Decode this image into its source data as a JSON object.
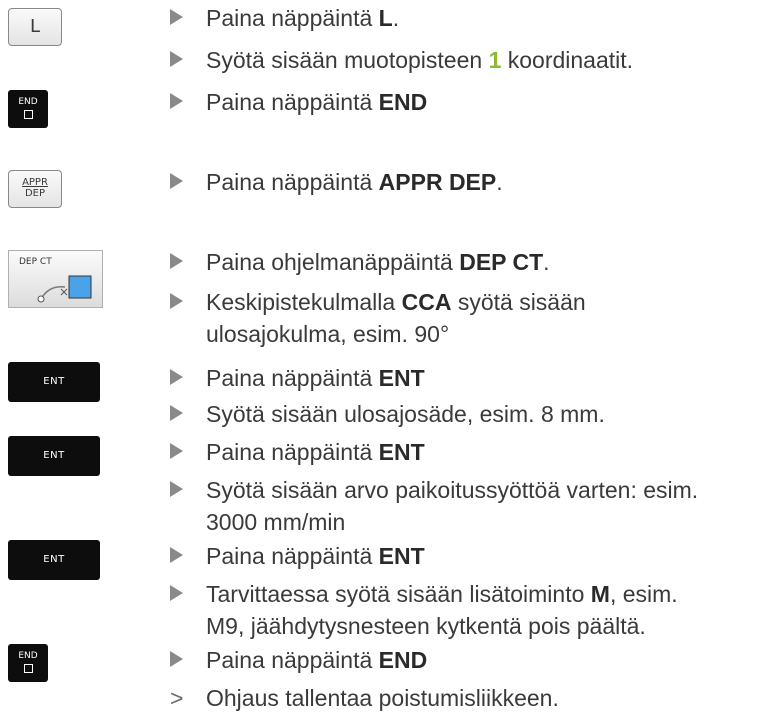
{
  "keys": {
    "L": "L",
    "end_1": "END",
    "appr_top": "APPR",
    "appr_bottom": "DEP",
    "softkey": "DEP CT",
    "ent_1": "ENT",
    "ent_2": "ENT",
    "ent_3": "ENT",
    "end_2": "END"
  },
  "steps": [
    {
      "pre": "Paina näppäintä ",
      "bold": "L",
      "post": "."
    },
    {
      "pre": "Syötä sisään muotopisteen ",
      "hl": "1",
      "post": " koordinaatit."
    },
    {
      "pre": "Paina näppäintä ",
      "bold": "END",
      "post": ""
    },
    {
      "pre": "Paina näppäintä ",
      "bold": "APPR DEP",
      "post": "."
    },
    {
      "pre": "Paina ohjelmanäppäintä ",
      "bold": "DEP CT",
      "post": "."
    },
    {
      "pre": "Keskipistekulmalla ",
      "bold": "CCA",
      "line1_post": " syötä sisään",
      "line2": "ulosajokulma, esim. 90°"
    },
    {
      "pre": "Paina näppäintä ",
      "bold": "ENT",
      "post": ""
    },
    {
      "text": "Syötä sisään ulosajosäde, esim. 8 mm."
    },
    {
      "pre": "Paina näppäintä ",
      "bold": "ENT",
      "post": ""
    },
    {
      "line1": "Syötä sisään arvo paikoitussyöttöä varten: esim.",
      "line2": "3000 mm/min"
    },
    {
      "pre": "Paina näppäintä ",
      "bold": "ENT",
      "post": ""
    },
    {
      "pre": "Tarvittaessa syötä sisään lisätoiminto ",
      "bold": "M",
      "line1_post": ", esim.",
      "line2": "M9, jäähdytysnesteen kytkentä pois päältä."
    },
    {
      "pre": "Paina näppäintä ",
      "bold": "END",
      "post": ""
    },
    {
      "text": "Ohjaus tallentaa poistumisliikkeen."
    }
  ],
  "result_marker": ">"
}
